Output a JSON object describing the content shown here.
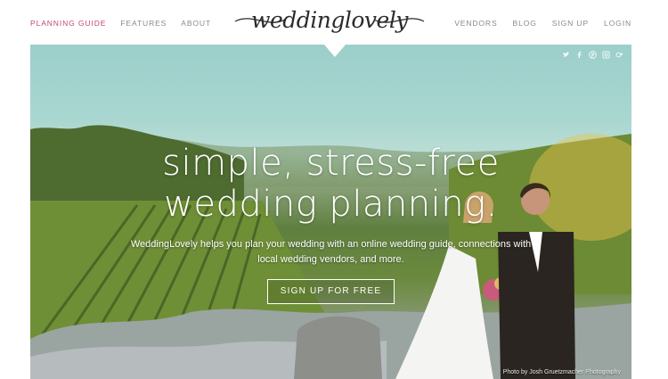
{
  "nav": {
    "left": [
      {
        "label": "PLANNING GUIDE",
        "active": true
      },
      {
        "label": "FEATURES"
      },
      {
        "label": "ABOUT"
      }
    ],
    "right": [
      {
        "label": "VENDORS"
      },
      {
        "label": "BLOG"
      },
      {
        "label": "SIGN UP"
      },
      {
        "label": "LOGIN"
      }
    ]
  },
  "logo": {
    "text": "weddinglovely"
  },
  "social": [
    "twitter-icon",
    "facebook-icon",
    "pinterest-icon",
    "instagram-icon",
    "google-plus-icon"
  ],
  "hero": {
    "headline_line1": "simple, stress-free",
    "headline_line2": "wedding planning.",
    "subtext": "WeddingLovely helps you plan your wedding with an online wedding guide, connections with local wedding vendors, and more.",
    "cta_label": "SIGN UP FOR FREE",
    "credit": "Photo by Josh Gruetzmacher Photography"
  },
  "colors": {
    "accent": "#c2476b",
    "nav_text": "#8a8a8a"
  }
}
